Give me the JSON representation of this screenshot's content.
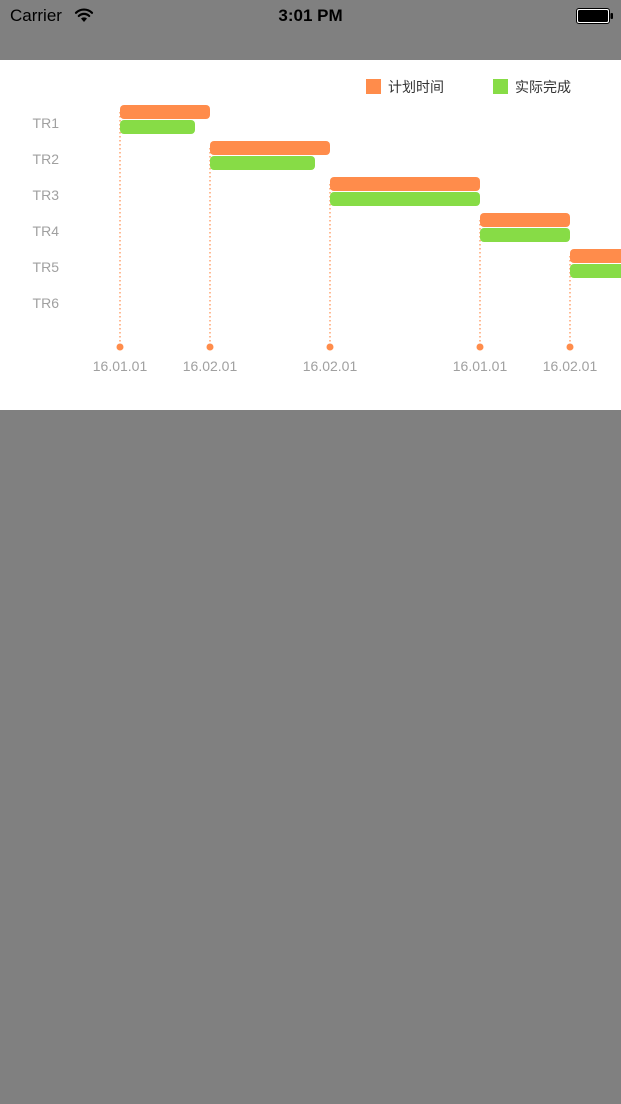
{
  "status_bar": {
    "carrier": "Carrier",
    "time": "3:01 PM",
    "wifi_icon": "wifi-icon",
    "battery_icon": "battery-icon"
  },
  "colors": {
    "background": "#808080",
    "planned": "#ff8c4b",
    "actual": "#87dc46",
    "axis_text": "#a0a0a0",
    "legend_text": "#333333"
  },
  "chart_data": {
    "type": "gantt",
    "title": "",
    "legend": {
      "position": "top-right",
      "items": [
        {
          "key": "planned",
          "label": "计划时间"
        },
        {
          "key": "actual",
          "label": "实际完成"
        }
      ]
    },
    "categories": [
      "TR1",
      "TR2",
      "TR3",
      "TR4",
      "TR5",
      "TR6"
    ],
    "x_ticks": [
      {
        "label": "16.01.01",
        "x": 0
      },
      {
        "label": "16.02.01",
        "x": 0.9
      },
      {
        "label": "16.02.01",
        "x": 2.1
      },
      {
        "label": "16.01.01",
        "x": 3.6
      },
      {
        "label": "16.02.01",
        "x": 4.5
      }
    ],
    "series": [
      {
        "name": "计划时间",
        "key": "planned",
        "tasks": [
          {
            "category": "TR1",
            "start": 0,
            "end": 0.9
          },
          {
            "category": "TR2",
            "start": 0.9,
            "end": 2.1
          },
          {
            "category": "TR3",
            "start": 2.1,
            "end": 3.6
          },
          {
            "category": "TR4",
            "start": 3.6,
            "end": 4.5
          },
          {
            "category": "TR5",
            "start": 4.5,
            "end": 5.1
          }
        ]
      },
      {
        "name": "实际完成",
        "key": "actual",
        "tasks": [
          {
            "category": "TR1",
            "start": 0,
            "end": 0.75
          },
          {
            "category": "TR2",
            "start": 0.9,
            "end": 1.95
          },
          {
            "category": "TR3",
            "start": 2.1,
            "end": 3.6
          },
          {
            "category": "TR4",
            "start": 3.6,
            "end": 4.5
          },
          {
            "category": "TR5",
            "start": 4.5,
            "end": 5.1
          }
        ]
      }
    ]
  }
}
